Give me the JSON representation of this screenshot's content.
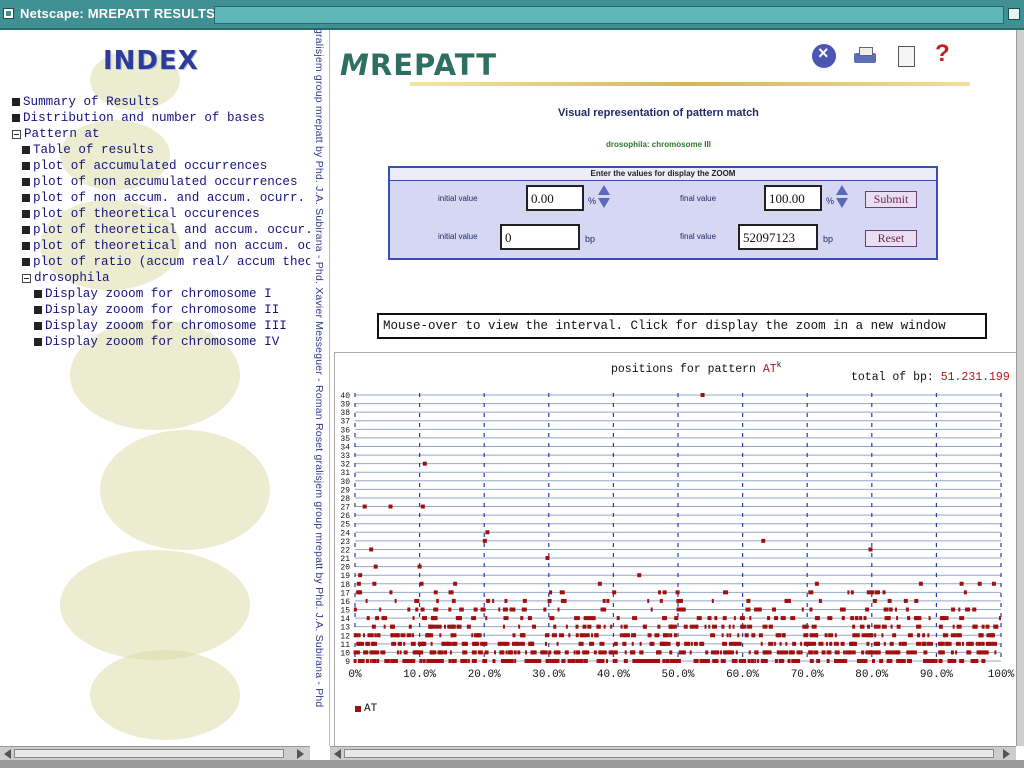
{
  "window": {
    "title": "Netscape: MREPATT RESULTS"
  },
  "left_frame": {
    "index_title": "INDEX",
    "tree": [
      {
        "label": "Summary of Results",
        "level": 0,
        "marker": "box"
      },
      {
        "label": "Distribution and number of bases",
        "level": 0,
        "marker": "box"
      },
      {
        "label": "Pattern at",
        "level": 0,
        "marker": "minus"
      },
      {
        "label": "Table of results",
        "level": 1,
        "marker": "box"
      },
      {
        "label": "plot of accumulated occurrences",
        "level": 1,
        "marker": "box"
      },
      {
        "label": "plot of non accumulated occurrences",
        "level": 1,
        "marker": "box"
      },
      {
        "label": "plot of non accum. and accum. ocurr.",
        "level": 1,
        "marker": "box"
      },
      {
        "label": "plot of theoretical occurences",
        "level": 1,
        "marker": "box"
      },
      {
        "label": "plot of theoretical and accum. occur.",
        "level": 1,
        "marker": "box"
      },
      {
        "label": "plot of theoretical and non accum. oc",
        "level": 1,
        "marker": "box"
      },
      {
        "label": "plot of ratio (accum real/ accum theo",
        "level": 1,
        "marker": "box"
      },
      {
        "label": "drosophila",
        "level": 1,
        "marker": "minus"
      },
      {
        "label": "Display zooom for chromosome I",
        "level": 2,
        "marker": "box"
      },
      {
        "label": "Display zooom for chromosome II",
        "level": 2,
        "marker": "box"
      },
      {
        "label": "Display zooom for chromosome III",
        "level": 2,
        "marker": "box"
      },
      {
        "label": "Display zooom for chromosome IV",
        "level": 2,
        "marker": "box"
      }
    ]
  },
  "sidebar_text": "gralisjem group   mrepatt by Phd. J.A. Subirana - Phd. Xavier Messeguer - Roman Roset   gralisjem group   mrepatt by Phd. J.A. Subirana - Phd",
  "header": {
    "logo": "REPATT",
    "logo_prefix": "M",
    "icons": [
      "close-circle-icon",
      "printer-icon",
      "document-icon",
      "help-question-icon"
    ],
    "help_symbol": "?"
  },
  "main": {
    "title": "Visual representation of pattern match",
    "subtitle": "drosophila: chromosome III",
    "zoom_box": {
      "heading": "Enter the values for display the ZOOM",
      "initial_label": "initial value",
      "final_label": "final value",
      "initial_percent": "0.00",
      "final_percent": "100.00",
      "percent_unit": "%",
      "initial_bp": "0",
      "final_bp": "52097123",
      "bp_unit": "bp",
      "submit_label": "Submit",
      "reset_label": "Reset"
    },
    "hint": "Mouse-over to view the interval. Click for display the zoom in a new window"
  },
  "plot": {
    "title_prefix": "positions for pattern ",
    "pattern": "AT",
    "superscript": "k",
    "total_label": "total of bp: ",
    "total_value": "51.231.199",
    "legend_label": "AT",
    "colors": {
      "mark": "#a01010",
      "row_line": "#8fa8c8",
      "grid": "#2a3aa8"
    }
  },
  "chart_data": {
    "type": "scatter",
    "title": "positions for pattern AT^k",
    "xlabel": "",
    "ylabel": "",
    "x_ticks": [
      "0%",
      "10.0%",
      "20.0%",
      "30.0%",
      "40.0%",
      "50.0%",
      "60.0%",
      "70.0%",
      "80.0%",
      "90.0%",
      "100%"
    ],
    "y_ticks": [
      9,
      10,
      11,
      12,
      13,
      14,
      15,
      16,
      17,
      18,
      19,
      20,
      21,
      22,
      23,
      24,
      25,
      26,
      27,
      28,
      29,
      30,
      31,
      32,
      33,
      34,
      35,
      36,
      37,
      38,
      39,
      40
    ],
    "xlim": [
      0,
      100
    ],
    "ylim": [
      9,
      40
    ],
    "series": [
      {
        "name": "AT",
        "color": "#a01010"
      }
    ],
    "sparse_points": [
      [
        53.8,
        40
      ],
      [
        10.8,
        32
      ],
      [
        1.5,
        27
      ],
      [
        5.5,
        27
      ],
      [
        10.5,
        27
      ],
      [
        20.5,
        24
      ],
      [
        20.1,
        23
      ],
      [
        63.2,
        23
      ],
      [
        2.5,
        22
      ],
      [
        79.8,
        22
      ],
      [
        29.8,
        21
      ],
      [
        3.2,
        20
      ],
      [
        10.0,
        20
      ],
      [
        0.8,
        19
      ],
      [
        44.0,
        19
      ],
      [
        0.6,
        18
      ],
      [
        3.0,
        18
      ],
      [
        10.3,
        18
      ],
      [
        15.5,
        18
      ],
      [
        37.9,
        18
      ],
      [
        71.5,
        18
      ],
      [
        87.6,
        18
      ],
      [
        93.9,
        18
      ],
      [
        96.7,
        18
      ],
      [
        98.9,
        18
      ]
    ],
    "dense_rows": [
      {
        "y": 9,
        "count": 200
      },
      {
        "y": 10,
        "count": 170
      },
      {
        "y": 11,
        "count": 140
      },
      {
        "y": 12,
        "count": 110
      },
      {
        "y": 13,
        "count": 85
      },
      {
        "y": 14,
        "count": 62
      },
      {
        "y": 15,
        "count": 45
      },
      {
        "y": 16,
        "count": 30
      },
      {
        "y": 17,
        "count": 20
      }
    ]
  }
}
